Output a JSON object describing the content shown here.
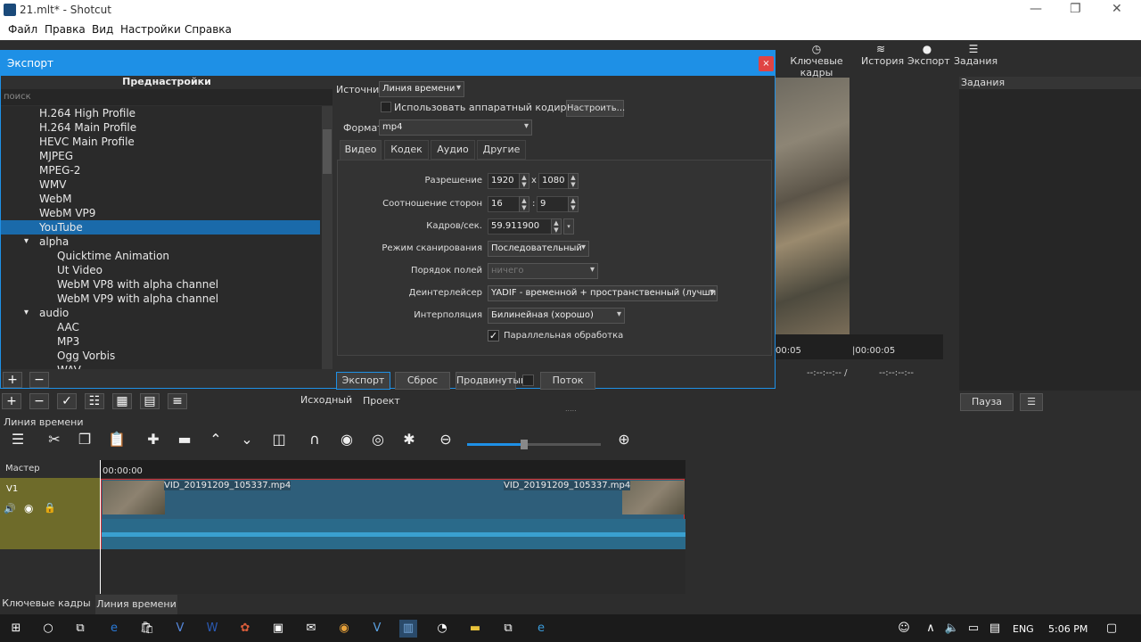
{
  "window": {
    "title": "21.mlt* - Shotcut",
    "minimize": "—",
    "maximize": "❐",
    "close": "✕"
  },
  "menu": [
    "Файл",
    "Правка",
    "Вид",
    "Настройки",
    "Справка"
  ],
  "toolbar": {
    "keyframes": "Ключевые кадры",
    "history": "История",
    "export": "Экспорт",
    "jobs": "Задания"
  },
  "dialog": {
    "title": "Экспорт",
    "close": "×",
    "presets_header": "Преднастройки",
    "search_placeholder": "поиск",
    "presets": [
      {
        "label": "H.264 High Profile",
        "level": 1
      },
      {
        "label": "H.264 Main Profile",
        "level": 1
      },
      {
        "label": "HEVC Main Profile",
        "level": 1
      },
      {
        "label": "MJPEG",
        "level": 1
      },
      {
        "label": "MPEG-2",
        "level": 1
      },
      {
        "label": "WMV",
        "level": 1
      },
      {
        "label": "WebM",
        "level": 1
      },
      {
        "label": "WebM VP9",
        "level": 1
      },
      {
        "label": "YouTube",
        "level": 1,
        "selected": true
      },
      {
        "label": "alpha",
        "level": 1,
        "group": true
      },
      {
        "label": "Quicktime Animation",
        "level": 2
      },
      {
        "label": "Ut Video",
        "level": 2
      },
      {
        "label": "WebM VP8 with alpha channel",
        "level": 2
      },
      {
        "label": "WebM VP9 with alpha channel",
        "level": 2
      },
      {
        "label": "audio",
        "level": 1,
        "group": true
      },
      {
        "label": "AAC",
        "level": 2
      },
      {
        "label": "MP3",
        "level": 2
      },
      {
        "label": "Ogg Vorbis",
        "level": 2
      },
      {
        "label": "WAV",
        "level": 2
      }
    ],
    "add": "+",
    "remove": "−",
    "source_label": "Источник",
    "source_value": "Линия времени",
    "hw_encoder": "Использовать аппаратный кодировщик",
    "configure": "Настроить...",
    "format_label": "Формат",
    "format_value": "mp4",
    "tabs": [
      "Видео",
      "Кодек",
      "Аудио",
      "Другие"
    ],
    "resolution_label": "Разрешение",
    "res_w": "1920",
    "res_x": "x",
    "res_h": "1080",
    "aspect_label": "Соотношение сторон",
    "aspect_w": "16",
    "aspect_sep": ":",
    "aspect_h": "9",
    "fps_label": "Кадров/сек.",
    "fps_value": "59.911900",
    "scan_label": "Режим сканирования",
    "scan_value": "Последовательный",
    "field_order_label": "Порядок полей",
    "field_order_value": "ничего",
    "deint_label": "Деинтерлейсер",
    "deint_value": "YADIF - временной + пространственный (лучший)",
    "interp_label": "Интерполяция",
    "interp_value": "Билинейная (хорошо)",
    "parallel": "Параллельная обработка",
    "btn_export": "Экспорт",
    "btn_reset": "Сброс",
    "btn_advanced": "Продвинутый",
    "btn_stream": "Поток"
  },
  "main": {
    "player_time_a": "00:05",
    "player_time_b": "|00:00:05",
    "timecode_a": "--:--:--:-- /",
    "timecode_b": "--:--:--:--",
    "jobs_title": "Задания",
    "pause": "Пауза",
    "jobs_menu": "☰",
    "tab_source": "Исходный",
    "tab_project": "Проект",
    "resize_grip": "....."
  },
  "timeline": {
    "title": "Линия времени",
    "master": "Мастер",
    "track": "V1",
    "ruler_start": "00:00:00",
    "clip_label_a": "VID_20191209_105337.mp4",
    "clip_label_b": "VID_20191209_105337.mp4"
  },
  "bottom_tabs": [
    "Ключевые кадры",
    "Линия времени"
  ],
  "taskbar": {
    "lang": "ENG",
    "time": "5:06 PM"
  }
}
